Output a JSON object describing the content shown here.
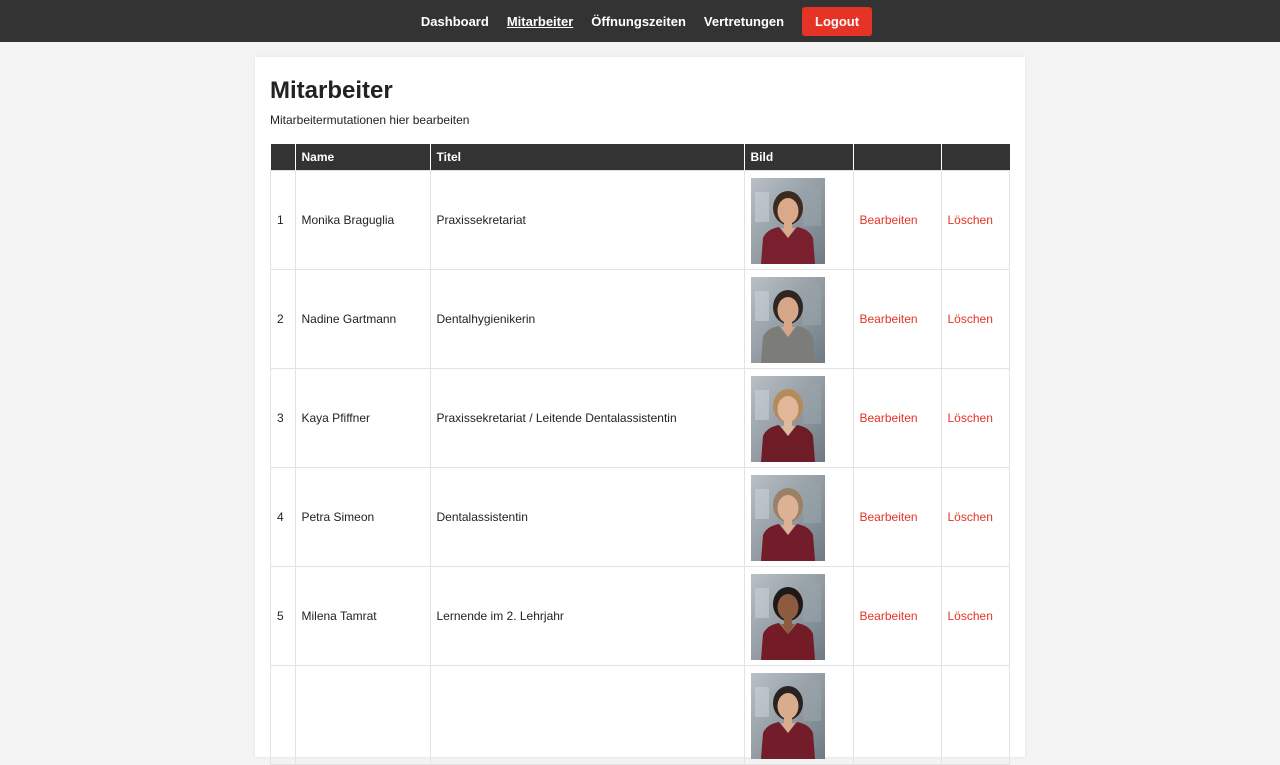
{
  "nav": {
    "items": [
      {
        "label": "Dashboard",
        "active": false
      },
      {
        "label": "Mitarbeiter",
        "active": true
      },
      {
        "label": "Öffnungszeiten",
        "active": false
      },
      {
        "label": "Vertretungen",
        "active": false
      }
    ],
    "logout_label": "Logout"
  },
  "page": {
    "title": "Mitarbeiter",
    "subtitle": "Mitarbeitermutationen hier bearbeiten"
  },
  "table": {
    "headers": [
      "",
      "Name",
      "Titel",
      "Bild",
      "",
      ""
    ],
    "edit_label": "Bearbeiten",
    "delete_label": "Löschen",
    "rows": [
      {
        "num": "1",
        "name": "Monika Braguglia",
        "title": "Praxissekretariat",
        "scrub": "#7a1f2d",
        "hair": "#3a2a22",
        "skin": "#d9a98a"
      },
      {
        "num": "2",
        "name": "Nadine Gartmann",
        "title": "Dentalhygienikerin",
        "scrub": "#7c7c78",
        "hair": "#2e2622",
        "skin": "#d6a688"
      },
      {
        "num": "3",
        "name": "Kaya Pfiffner",
        "title": "Praxissekretariat / Leitende Dentalassistentin",
        "scrub": "#6e1c26",
        "hair": "#b58a5c",
        "skin": "#e2b89b"
      },
      {
        "num": "4",
        "name": "Petra Simeon",
        "title": "Dentalassistentin",
        "scrub": "#721d29",
        "hair": "#9a8066",
        "skin": "#ddb193"
      },
      {
        "num": "5",
        "name": "Milena Tamrat",
        "title": "Lernende im 2. Lehrjahr",
        "scrub": "#731c28",
        "hair": "#1e1816",
        "skin": "#8d5b3f"
      },
      {
        "num": "",
        "name": "",
        "title": "",
        "scrub": "#721d29",
        "hair": "#2a2220",
        "skin": "#d9ac8e"
      }
    ]
  },
  "colors": {
    "accent": "#e53326",
    "header_bg": "#333333"
  }
}
